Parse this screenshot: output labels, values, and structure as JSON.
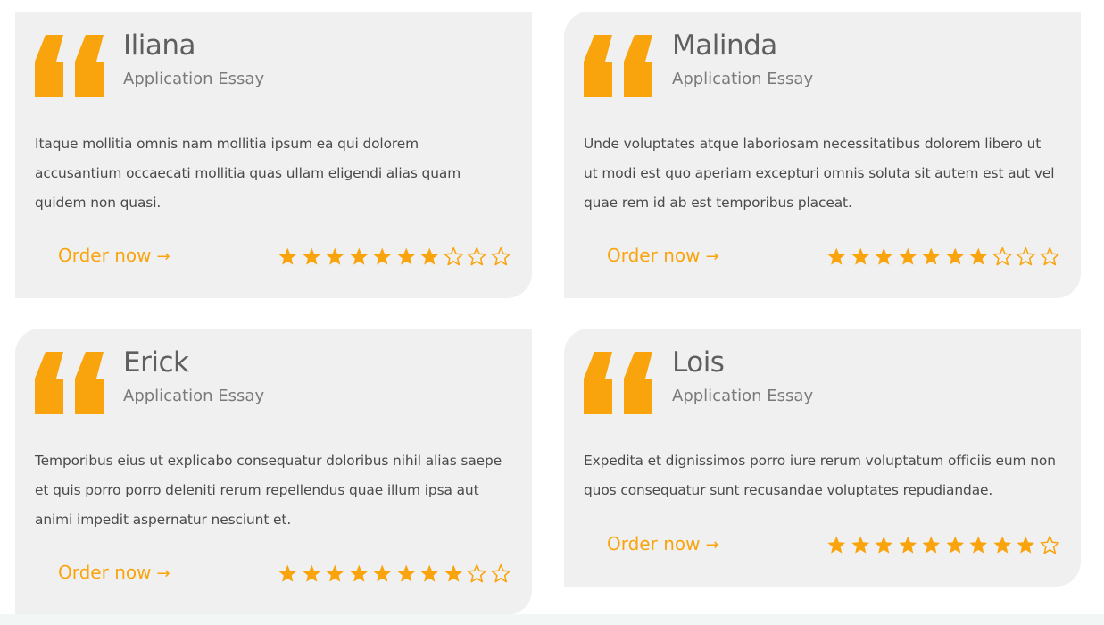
{
  "colors": {
    "accent": "#f9a40d",
    "card_bg": "#f0f0f0",
    "name": "#5f5f5f",
    "text": "#4a4a4a"
  },
  "testimonials": [
    {
      "name": "Iliana",
      "subtitle": "Application Essay",
      "text": "Itaque mollitia omnis nam mollitia ipsum ea qui dolorem accusantium occaecati mollitia quas ullam eligendi alias quam quidem non quasi.",
      "cta": "Order now",
      "cta_icon": "arrow-right-icon",
      "rating": 7,
      "rating_max": 10
    },
    {
      "name": "Malinda",
      "subtitle": "Application Essay",
      "text": "Unde voluptates atque laboriosam necessitatibus dolorem libero ut ut modi est quo aperiam excepturi omnis soluta sit autem est aut vel quae rem id ab est temporibus placeat.",
      "cta": "Order now",
      "cta_icon": "arrow-right-icon",
      "rating": 7,
      "rating_max": 10
    },
    {
      "name": "Erick",
      "subtitle": "Application Essay",
      "text": "Temporibus eius ut explicabo consequatur doloribus nihil alias saepe et quis porro porro deleniti rerum repellendus quae illum ipsa aut animi impedit aspernatur nesciunt et.",
      "cta": "Order now",
      "cta_icon": "arrow-right-icon",
      "rating": 8,
      "rating_max": 10
    },
    {
      "name": "Lois",
      "subtitle": "Application Essay",
      "text": "Expedita et dignissimos porro iure rerum voluptatum officiis eum non quos consequatur sunt recusandae voluptates repudiandae.",
      "cta": "Order now",
      "cta_icon": "arrow-right-icon",
      "rating": 9,
      "rating_max": 10
    }
  ]
}
